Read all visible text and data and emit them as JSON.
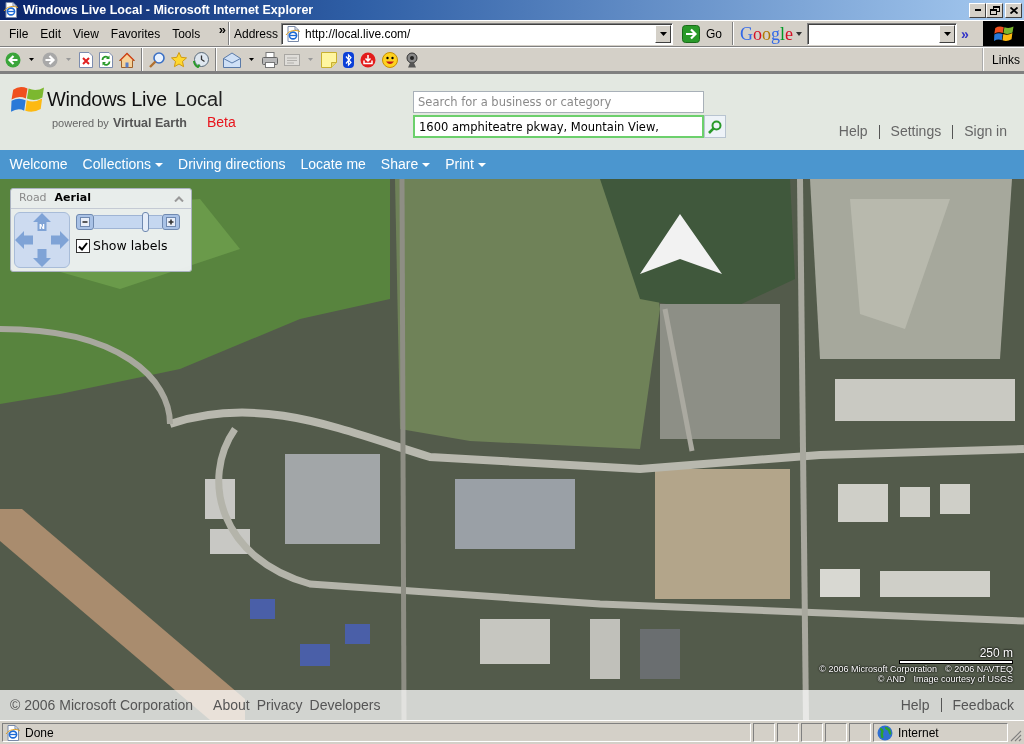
{
  "window": {
    "title": "Windows Live Local - Microsoft Internet Explorer"
  },
  "menu_bar": {
    "items": [
      "File",
      "Edit",
      "View",
      "Favorites",
      "Tools"
    ],
    "overflow": "»"
  },
  "address_bar": {
    "label": "Address",
    "value": "http://local.live.com/",
    "go_button": "Go"
  },
  "google_toolbar": {
    "logo": "Google",
    "overflow": "»"
  },
  "toolbar": {
    "groups": [
      [
        {
          "kind": "back",
          "disabled": false,
          "menu": true
        },
        {
          "kind": "forward",
          "disabled": true,
          "menu": true
        },
        {
          "kind": "stop",
          "disabled": false,
          "menu": false
        },
        {
          "kind": "refresh",
          "disabled": false,
          "menu": false
        },
        {
          "kind": "home",
          "disabled": false,
          "menu": false
        }
      ],
      [
        {
          "kind": "search",
          "disabled": false,
          "menu": false
        },
        {
          "kind": "favorites",
          "disabled": false,
          "menu": false
        },
        {
          "kind": "history",
          "disabled": false,
          "menu": false
        }
      ],
      [
        {
          "kind": "mail",
          "disabled": false,
          "menu": true
        },
        {
          "kind": "print",
          "disabled": false,
          "menu": false
        },
        {
          "kind": "edit",
          "disabled": true,
          "menu": true
        },
        {
          "kind": "note",
          "disabled": false,
          "menu": false
        },
        {
          "kind": "bluetooth",
          "disabled": false,
          "menu": false
        },
        {
          "kind": "download",
          "disabled": false,
          "menu": false
        },
        {
          "kind": "messenger",
          "disabled": false,
          "menu": false
        },
        {
          "kind": "webcam",
          "disabled": false,
          "menu": false
        }
      ]
    ],
    "links": "Links"
  },
  "site_header": {
    "logo": {
      "name": "Windows Live",
      "product": "Local",
      "tagline": "powered by",
      "brand": "Virtual Earth",
      "badge": "Beta"
    },
    "search": {
      "what_placeholder": "Search for a business or category",
      "where_value": "1600 amphiteatre pkway, Mountain View,"
    },
    "links": [
      "Help",
      "Settings",
      "Sign in"
    ]
  },
  "nav": [
    {
      "label": "Welcome",
      "dropdown": false
    },
    {
      "label": "Collections",
      "dropdown": true
    },
    {
      "label": "Driving directions",
      "dropdown": false
    },
    {
      "label": "Locate me",
      "dropdown": false
    },
    {
      "label": "Share",
      "dropdown": true
    },
    {
      "label": "Print",
      "dropdown": true
    }
  ],
  "map": {
    "control": {
      "tabs": [
        {
          "label": "Road",
          "selected": false
        },
        {
          "label": "Aerial",
          "selected": true
        }
      ],
      "pan_north": "N",
      "zoom": {
        "level": 0.78
      },
      "show_labels": {
        "label": "Show labels",
        "checked": true
      }
    },
    "scale": "250 m",
    "credits": [
      [
        "© 2006 Microsoft Corporation",
        "© 2006 NAVTEQ"
      ],
      [
        "© AND",
        "Image courtesy of USGS"
      ]
    ]
  },
  "footer": {
    "copyright": "© 2006 Microsoft Corporation",
    "links": [
      "About",
      "Privacy",
      "Developers"
    ],
    "right_links": [
      "Help",
      "Feedback"
    ]
  },
  "status_bar": {
    "text": "Done",
    "zone": "Internet"
  }
}
